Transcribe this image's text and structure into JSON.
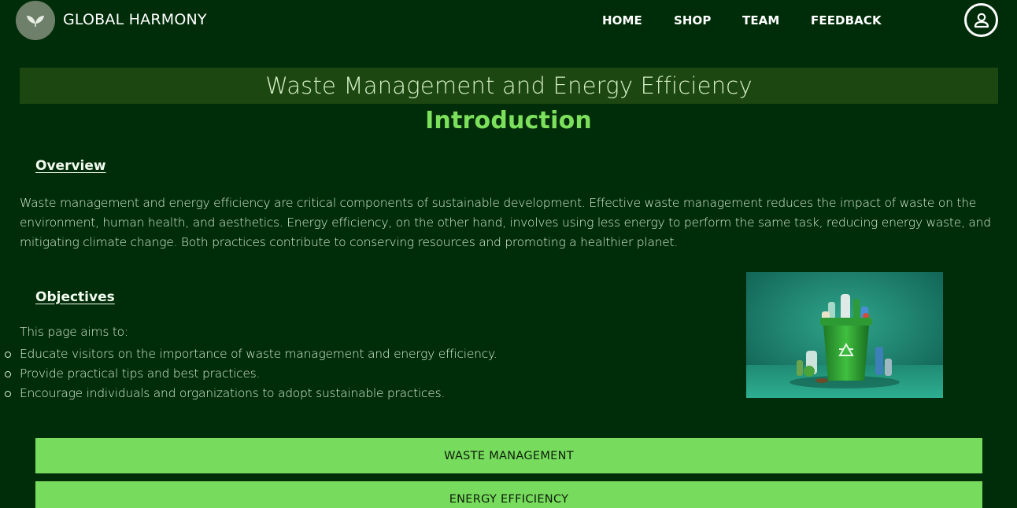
{
  "header": {
    "brand": "GLOBAL HARMONY",
    "logo_icon": "leaf-logo-icon",
    "nav": [
      {
        "label": "HOME"
      },
      {
        "label": "SHOP"
      },
      {
        "label": "TEAM"
      },
      {
        "label": "FEEDBACK"
      }
    ],
    "profile_icon": "user-profile-icon"
  },
  "main": {
    "title": "Waste Management and Energy Efficiency",
    "subtitle": "Introduction",
    "overview": {
      "heading": "Overview",
      "text": "Waste management and energy efficiency are critical components of sustainable development. Effective waste management reduces the impact of waste on the environment, human health, and aesthetics. Energy efficiency, on the other hand, involves using less energy to perform the same task, reducing energy waste, and mitigating climate change. Both practices contribute to conserving resources and promoting a healthier planet."
    },
    "objectives": {
      "heading": "Objectives",
      "intro": "This page aims to:",
      "items": [
        "Educate visitors on the importance of waste management and energy efficiency.",
        "Provide practical tips and best practices.",
        "Encourage individuals and organizations to adopt sustainable practices."
      ]
    },
    "image_icon": "recycling-bin-image",
    "sections": [
      {
        "label": "WASTE MANAGEMENT"
      },
      {
        "label": "ENERGY EFFICIENCY"
      }
    ]
  },
  "colors": {
    "background": "#002d09",
    "title_band": "#1c4711",
    "accent_green": "#7ce05c",
    "button_green": "#77db5e"
  }
}
